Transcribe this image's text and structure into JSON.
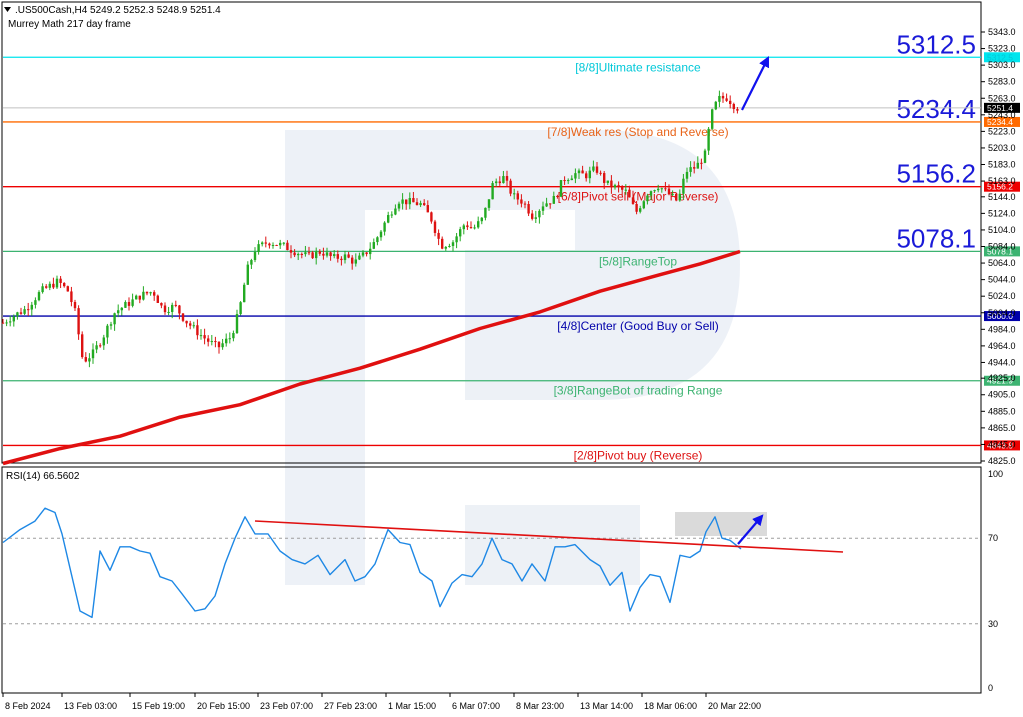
{
  "header": {
    "symbol_line": ".US500Cash,H4  5249.2 5252.3 5248.9 5251.4",
    "indicator_line": "Murrey Math 217 day frame"
  },
  "rsi": {
    "label": "RSI(14) 66.5602",
    "ticks": [
      100,
      70,
      30,
      0
    ],
    "ylim": [
      0,
      100
    ],
    "levels": [
      70,
      30
    ]
  },
  "chart_data": {
    "type": "candlestick",
    "ylim": [
      4815,
      5360
    ],
    "y_ticks": [
      "5343.0",
      "5323.0",
      "5303.0",
      "5283.0",
      "5263.0",
      "5243.0",
      "5223.0",
      "5203.0",
      "5183.0",
      "5163.0",
      "5144.0",
      "5124.0",
      "5104.0",
      "5084.0",
      "5064.0",
      "5044.0",
      "5024.0",
      "5004.0",
      "4984.0",
      "4964.0",
      "4944.0",
      "4925.0",
      "4905.0",
      "4885.0",
      "4865.0",
      "4845.0",
      "4825.0"
    ],
    "x_ticks": [
      "8 Feb 2024",
      "13 Feb 03:00",
      "15 Feb 19:00",
      "20 Feb 15:00",
      "23 Feb 07:00",
      "27 Feb 23:00",
      "1 Mar 15:00",
      "6 Mar 07:00",
      "8 Mar 23:00",
      "13 Mar 14:00",
      "18 Mar 06:00",
      "20 Mar 22:00"
    ],
    "current_price": "5251.4",
    "current_value": 5251.4,
    "levels": [
      {
        "price": 5312.5,
        "price_label": "5312.5",
        "big_label": "5312.5",
        "text": "[8/8]Ultimate resistance",
        "color": "#00e5ee",
        "text_color": "#00c8d8",
        "tag_text_color": "#00c8d8"
      },
      {
        "price": 5234.4,
        "price_label": "5234.4",
        "big_label": "5234.4",
        "text": "[7/8]Weak res (Stop and Reverse)",
        "color": "#ff6a00",
        "text_color": "#e8641a",
        "tag_text_color": "#ffffff"
      },
      {
        "price": 5156.2,
        "price_label": "5156.2",
        "big_label": "5156.2",
        "text": "[6/8]Pivot sell (Major Reverse)",
        "color": "#ee0000",
        "text_color": "#dd1111",
        "tag_text_color": "#ffffff"
      },
      {
        "price": 5078.1,
        "price_label": "5078.1",
        "big_label": "5078.1",
        "text": "[5/8]RangeTop",
        "color": "#3cb371",
        "text_color": "#3cb371",
        "tag_text_color": "#ffffff"
      },
      {
        "price": 5000.0,
        "price_label": "5000.0",
        "big_label": "",
        "text": "[4/8]Center (Good Buy or Sell)",
        "color": "#0000aa",
        "text_color": "#0000aa",
        "tag_text_color": "#ffffff"
      },
      {
        "price": 4921.9,
        "price_label": "4921.9",
        "big_label": "",
        "text": "[3/8]RangeBot of trading Range",
        "color": "#3cb371",
        "text_color": "#3cb371",
        "tag_text_color": "#ffffff"
      },
      {
        "price": 4843.8,
        "price_label": "4843.8",
        "big_label": "",
        "text": "[2/8]Pivot buy (Reverse)",
        "color": "#ee0000",
        "text_color": "#dd1111",
        "tag_text_color": "#ffffff"
      }
    ],
    "colors": {
      "bull": "#22aa22",
      "bear": "#dd1111",
      "ma": "#e01010",
      "rsi": "#1e88e5",
      "arrow": "#1111ee",
      "watermark": "#dfe6f0"
    }
  }
}
